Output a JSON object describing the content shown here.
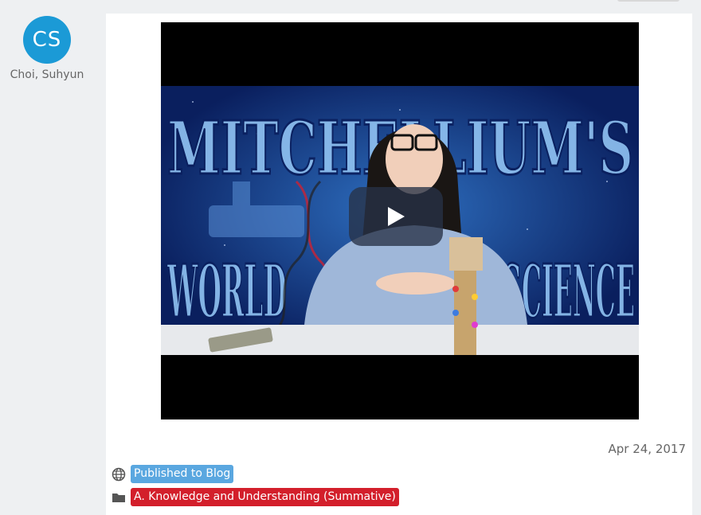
{
  "author": {
    "initials": "CS",
    "name": "Choi, Suhyun",
    "avatar_color": "#1b9ad6"
  },
  "post": {
    "date": "Apr 24, 2017",
    "video_thumbnail_text": [
      "MITCHELLIUM'S",
      "WORLD",
      "SCIENCE"
    ]
  },
  "tags": {
    "published": "Published to Blog",
    "criterion": "A. Knowledge and Understanding (Summative)"
  },
  "colors": {
    "published_badge": "#5aa7e0",
    "criterion_badge": "#d31f2b"
  },
  "icons": {
    "published": "globe-icon",
    "criterion": "folder-icon",
    "video": "play-icon"
  }
}
